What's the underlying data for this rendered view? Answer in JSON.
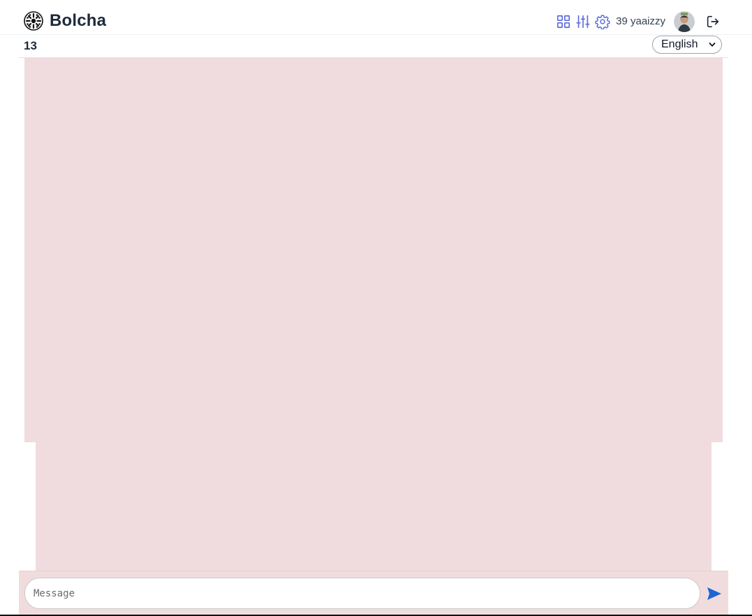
{
  "app": {
    "name": "Bolcha"
  },
  "header": {
    "icons": [
      "grid-icon",
      "sliders-icon",
      "gear-icon",
      "logout-icon"
    ],
    "user_label": "39 yaaizzy",
    "accent_color": "#5b6bd8"
  },
  "room": {
    "count": "13"
  },
  "language": {
    "selected": "English"
  },
  "composer": {
    "placeholder": "Message",
    "value": "",
    "send_color": "#1d64d6"
  },
  "colors": {
    "canvas_bg": "#f0dcde",
    "title_text": "#1e2a3b"
  }
}
